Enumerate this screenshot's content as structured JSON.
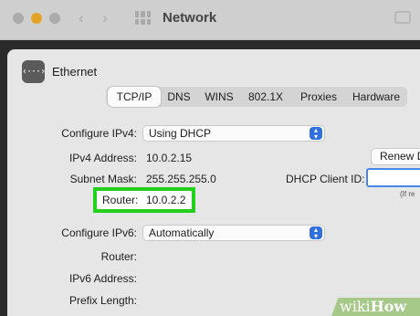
{
  "window": {
    "title": "Network"
  },
  "service": {
    "name": "Ethernet",
    "icon": "ethernet-icon",
    "icon_glyph": "‹···›"
  },
  "tabs": [
    "TCP/IP",
    "DNS",
    "WINS",
    "802.1X",
    "Proxies",
    "Hardware"
  ],
  "active_tab": "TCP/IP",
  "fields": {
    "configure_ipv4": {
      "label": "Configure IPv4:",
      "value": "Using DHCP"
    },
    "ipv4_address": {
      "label": "IPv4 Address:",
      "value": "10.0.2.15"
    },
    "subnet_mask": {
      "label": "Subnet Mask:",
      "value": "255.255.255.0"
    },
    "router": {
      "label": "Router:",
      "value": "10.0.2.2"
    },
    "configure_ipv6": {
      "label": "Configure IPv6:",
      "value": "Automatically"
    },
    "router_v6": {
      "label": "Router:"
    },
    "ipv6_address": {
      "label": "IPv6 Address:"
    },
    "prefix_length": {
      "label": "Prefix Length:"
    },
    "dhcp_client_id": {
      "label": "DHCP Client ID:",
      "value": "",
      "hint": "(If re"
    }
  },
  "buttons": {
    "renew": "Renew D"
  },
  "highlight": {
    "target": "router",
    "color": "#23d11c"
  },
  "watermark": {
    "prefix": "wiki",
    "brand": "How"
  },
  "colors": {
    "accent": "#2f6fde",
    "focus": "#4a86e8"
  }
}
